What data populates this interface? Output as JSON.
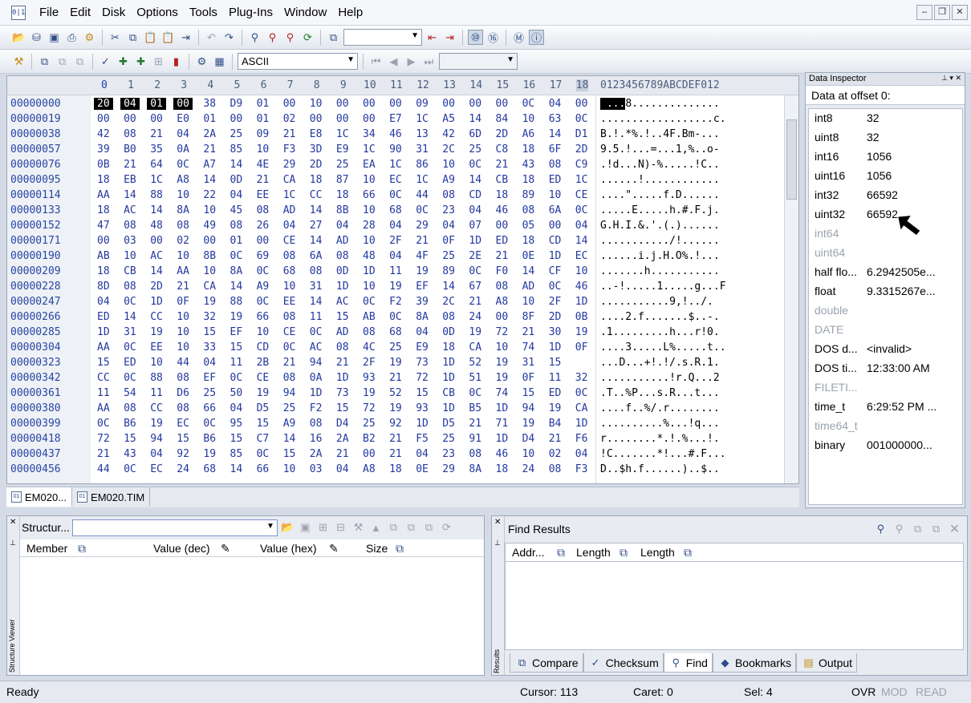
{
  "menu": {
    "items": [
      "File",
      "Edit",
      "Disk",
      "Options",
      "Tools",
      "Plug-Ins",
      "Window",
      "Help"
    ]
  },
  "toolbar": {
    "encoding": "ASCII"
  },
  "hex": {
    "columns": [
      "0",
      "1",
      "2",
      "3",
      "4",
      "5",
      "6",
      "7",
      "8",
      "9",
      "10",
      "11",
      "12",
      "13",
      "14",
      "15",
      "16",
      "17",
      "18"
    ],
    "ascii_header": "0123456789ABCDEF012",
    "rows": [
      {
        "off": "00000000",
        "hex": [
          "20",
          "04",
          "01",
          "00",
          "38",
          "D9",
          "01",
          "00",
          "10",
          "00",
          "00",
          "00",
          "09",
          "00",
          "00",
          "00",
          "0C",
          "04",
          "00"
        ],
        "ascii": " ...8.............."
      },
      {
        "off": "00000019",
        "hex": [
          "00",
          "00",
          "00",
          "E0",
          "01",
          "00",
          "01",
          "02",
          "00",
          "00",
          "00",
          "E7",
          "1C",
          "A5",
          "14",
          "84",
          "10",
          "63",
          "0C"
        ],
        "ascii": "..................c."
      },
      {
        "off": "00000038",
        "hex": [
          "42",
          "08",
          "21",
          "04",
          "2A",
          "25",
          "09",
          "21",
          "E8",
          "1C",
          "34",
          "46",
          "13",
          "42",
          "6D",
          "2D",
          "A6",
          "14",
          "D1"
        ],
        "ascii": "B.!.*%.!..4F.Bm-..."
      },
      {
        "off": "00000057",
        "hex": [
          "39",
          "B0",
          "35",
          "0A",
          "21",
          "85",
          "10",
          "F3",
          "3D",
          "E9",
          "1C",
          "90",
          "31",
          "2C",
          "25",
          "C8",
          "18",
          "6F",
          "2D"
        ],
        "ascii": "9.5.!...=...1,%..o-"
      },
      {
        "off": "00000076",
        "hex": [
          "0B",
          "21",
          "64",
          "0C",
          "A7",
          "14",
          "4E",
          "29",
          "2D",
          "25",
          "EA",
          "1C",
          "86",
          "10",
          "0C",
          "21",
          "43",
          "08",
          "C9"
        ],
        "ascii": ".!d...N)-%.....!C.."
      },
      {
        "off": "00000095",
        "hex": [
          "18",
          "EB",
          "1C",
          "A8",
          "14",
          "0D",
          "21",
          "CA",
          "18",
          "87",
          "10",
          "EC",
          "1C",
          "A9",
          "14",
          "CB",
          "18",
          "ED",
          "1C"
        ],
        "ascii": "......!............"
      },
      {
        "off": "00000114",
        "hex": [
          "AA",
          "14",
          "88",
          "10",
          "22",
          "04",
          "EE",
          "1C",
          "CC",
          "18",
          "66",
          "0C",
          "44",
          "08",
          "CD",
          "18",
          "89",
          "10",
          "CE"
        ],
        "ascii": "....\".....f.D......"
      },
      {
        "off": "00000133",
        "hex": [
          "18",
          "AC",
          "14",
          "8A",
          "10",
          "45",
          "08",
          "AD",
          "14",
          "8B",
          "10",
          "68",
          "0C",
          "23",
          "04",
          "46",
          "08",
          "6A",
          "0C"
        ],
        "ascii": ".....E.....h.#.F.j."
      },
      {
        "off": "00000152",
        "hex": [
          "47",
          "08",
          "48",
          "08",
          "49",
          "08",
          "26",
          "04",
          "27",
          "04",
          "28",
          "04",
          "29",
          "04",
          "07",
          "00",
          "05",
          "00",
          "04"
        ],
        "ascii": "G.H.I.&.'.(.)......"
      },
      {
        "off": "00000171",
        "hex": [
          "00",
          "03",
          "00",
          "02",
          "00",
          "01",
          "00",
          "CE",
          "14",
          "AD",
          "10",
          "2F",
          "21",
          "0F",
          "1D",
          "ED",
          "18",
          "CD",
          "14"
        ],
        "ascii": ".........../!......"
      },
      {
        "off": "00000190",
        "hex": [
          "AB",
          "10",
          "AC",
          "10",
          "8B",
          "0C",
          "69",
          "08",
          "6A",
          "08",
          "48",
          "04",
          "4F",
          "25",
          "2E",
          "21",
          "0E",
          "1D",
          "EC"
        ],
        "ascii": "......i.j.H.O%.!..."
      },
      {
        "off": "00000209",
        "hex": [
          "18",
          "CB",
          "14",
          "AA",
          "10",
          "8A",
          "0C",
          "68",
          "08",
          "0D",
          "1D",
          "11",
          "19",
          "89",
          "0C",
          "F0",
          "14",
          "CF",
          "10"
        ],
        "ascii": ".......h..........."
      },
      {
        "off": "00000228",
        "hex": [
          "8D",
          "08",
          "2D",
          "21",
          "CA",
          "14",
          "A9",
          "10",
          "31",
          "1D",
          "10",
          "19",
          "EF",
          "14",
          "67",
          "08",
          "AD",
          "0C",
          "46"
        ],
        "ascii": "..-!.....1.....g...F"
      },
      {
        "off": "00000247",
        "hex": [
          "04",
          "0C",
          "1D",
          "0F",
          "19",
          "88",
          "0C",
          "EE",
          "14",
          "AC",
          "0C",
          "F2",
          "39",
          "2C",
          "21",
          "A8",
          "10",
          "2F",
          "1D"
        ],
        "ascii": "...........9,!../."
      },
      {
        "off": "00000266",
        "hex": [
          "ED",
          "14",
          "CC",
          "10",
          "32",
          "19",
          "66",
          "08",
          "11",
          "15",
          "AB",
          "0C",
          "8A",
          "08",
          "24",
          "00",
          "8F",
          "2D",
          "0B"
        ],
        "ascii": "....2.f.......$..-."
      },
      {
        "off": "00000285",
        "hex": [
          "1D",
          "31",
          "19",
          "10",
          "15",
          "EF",
          "10",
          "CE",
          "0C",
          "AD",
          "08",
          "68",
          "04",
          "0D",
          "19",
          "72",
          "21",
          "30",
          "19"
        ],
        "ascii": ".1.........h...r!0."
      },
      {
        "off": "00000304",
        "hex": [
          "AA",
          "0C",
          "EE",
          "10",
          "33",
          "15",
          "CD",
          "0C",
          "AC",
          "08",
          "4C",
          "25",
          "E9",
          "18",
          "CA",
          "10",
          "74",
          "1D",
          "0F"
        ],
        "ascii": "....3.....L%.....t.."
      },
      {
        "off": "00000323",
        "hex": [
          "15",
          "ED",
          "10",
          "44",
          "04",
          "11",
          "2B",
          "21",
          "94",
          "21",
          "2F",
          "19",
          "73",
          "1D",
          "52",
          "19",
          "31",
          "15"
        ],
        "ascii": "...D...+!.!/.s.R.1."
      },
      {
        "off": "00000342",
        "hex": [
          "CC",
          "0C",
          "88",
          "08",
          "EF",
          "0C",
          "CE",
          "08",
          "0A",
          "1D",
          "93",
          "21",
          "72",
          "1D",
          "51",
          "19",
          "0F",
          "11",
          "32"
        ],
        "ascii": "...........!r.Q...2"
      },
      {
        "off": "00000361",
        "hex": [
          "11",
          "54",
          "11",
          "D6",
          "25",
          "50",
          "19",
          "94",
          "1D",
          "73",
          "19",
          "52",
          "15",
          "CB",
          "0C",
          "74",
          "15",
          "ED",
          "0C"
        ],
        "ascii": ".T..%P...s.R...t..."
      },
      {
        "off": "00000380",
        "hex": [
          "AA",
          "08",
          "CC",
          "08",
          "66",
          "04",
          "D5",
          "25",
          "F2",
          "15",
          "72",
          "19",
          "93",
          "1D",
          "B5",
          "1D",
          "94",
          "19",
          "CA"
        ],
        "ascii": "....f..%/.r........"
      },
      {
        "off": "00000399",
        "hex": [
          "0C",
          "B6",
          "19",
          "EC",
          "0C",
          "95",
          "15",
          "A9",
          "08",
          "D4",
          "25",
          "92",
          "1D",
          "D5",
          "21",
          "71",
          "19",
          "B4",
          "1D"
        ],
        "ascii": "..........%...!q..."
      },
      {
        "off": "00000418",
        "hex": [
          "72",
          "15",
          "94",
          "15",
          "B6",
          "15",
          "C7",
          "14",
          "16",
          "2A",
          "B2",
          "21",
          "F5",
          "25",
          "91",
          "1D",
          "D4",
          "21",
          "F6"
        ],
        "ascii": "r........*.!.%...!."
      },
      {
        "off": "00000437",
        "hex": [
          "21",
          "43",
          "04",
          "92",
          "19",
          "85",
          "0C",
          "15",
          "2A",
          "21",
          "00",
          "21",
          "04",
          "23",
          "08",
          "46",
          "10",
          "02",
          "04"
        ],
        "ascii": "!C.......*!...#.F..."
      },
      {
        "off": "00000456",
        "hex": [
          "44",
          "0C",
          "EC",
          "24",
          "68",
          "14",
          "66",
          "10",
          "03",
          "04",
          "A8",
          "18",
          "0E",
          "29",
          "8A",
          "18",
          "24",
          "08",
          "F3"
        ],
        "ascii": "D..$h.f......)..$.."
      }
    ]
  },
  "tabs": {
    "file1": "EM020...",
    "file2": "EM020.TIM"
  },
  "inspector": {
    "title": "Data Inspector",
    "subtitle": "Data at offset 0:",
    "rows": [
      {
        "name": "int8",
        "value": "32"
      },
      {
        "name": "uint8",
        "value": "32"
      },
      {
        "name": "int16",
        "value": "1056"
      },
      {
        "name": "uint16",
        "value": "1056"
      },
      {
        "name": "int32",
        "value": "66592"
      },
      {
        "name": "uint32",
        "value": "66592"
      },
      {
        "name": "int64",
        "value": ""
      },
      {
        "name": "uint64",
        "value": ""
      },
      {
        "name": "half flo...",
        "value": "6.2942505e..."
      },
      {
        "name": "float",
        "value": "9.3315267e..."
      },
      {
        "name": "double",
        "value": ""
      },
      {
        "name": "DATE",
        "value": ""
      },
      {
        "name": "DOS d...",
        "value": "<invalid>"
      },
      {
        "name": "DOS ti...",
        "value": "12:33:00 AM"
      },
      {
        "name": "FILETI...",
        "value": ""
      },
      {
        "name": "time_t",
        "value": "6:29:52 PM ..."
      },
      {
        "name": "time64_t",
        "value": ""
      },
      {
        "name": "binary",
        "value": "001000000..."
      }
    ]
  },
  "structure": {
    "side_title": "Structure Viewer",
    "dropdown_label": "Structur...",
    "columns": {
      "member": "Member",
      "dec": "Value (dec)",
      "hex": "Value (hex)",
      "size": "Size"
    }
  },
  "find": {
    "title": "Find Results",
    "side_title": "Results",
    "columns": {
      "addr": "Addr...",
      "len1": "Length",
      "len2": "Length"
    },
    "tabs": {
      "compare": "Compare",
      "checksum": "Checksum",
      "find": "Find",
      "bookmarks": "Bookmarks",
      "output": "Output"
    }
  },
  "status": {
    "ready": "Ready",
    "cursor": "Cursor: 113",
    "caret": "Caret: 0",
    "sel": "Sel: 4",
    "ovr": "OVR",
    "mod": "MOD",
    "read": "READ"
  }
}
